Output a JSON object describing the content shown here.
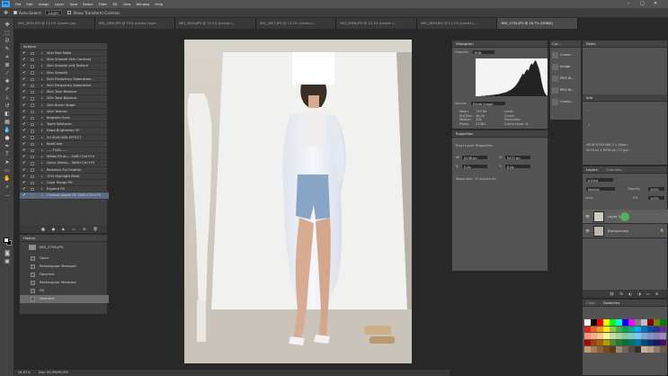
{
  "app": {
    "logo": "Ps",
    "menu": [
      "File",
      "Edit",
      "Image",
      "Layer",
      "Type",
      "Select",
      "Filter",
      "3D",
      "View",
      "Window",
      "Help"
    ],
    "window_controls": [
      "–",
      "□",
      "✕"
    ]
  },
  "options_bar": {
    "auto_select_label": "Auto-Select:",
    "auto_select_value": "Layer",
    "show_transform_label": "Show Transform Controls"
  },
  "doc_tabs": [
    {
      "label": "IMG_2855.JPG @ 13.1% (Levels Lay...",
      "active": false
    },
    {
      "label": "IMG_2856.JPG @ 10% (Levels Layer...",
      "active": false
    },
    {
      "label": "IMG_2855.JPG @ 13.1% (Levels L...",
      "active": false
    },
    {
      "label": "IMG_2857.JPG @ 13.1% (Levels L...",
      "active": false
    },
    {
      "label": "IMG_2858.JPG @ 13.1% (Levels L...",
      "active": false
    },
    {
      "label": "IMG_2859.JPG @ 11.1% (Levels L...",
      "active": false
    },
    {
      "label": "IMG_2795.JPG @ 16.7% (RGB/8)",
      "active": true
    }
  ],
  "actions": {
    "title": "Actions",
    "items": [
      "Skin Fast Make",
      "Skin Smooth Skin Contrast",
      "Skin Smooth and Texture",
      "Skin Smooth",
      "Skin Frequency Separation...",
      "Skin Frequency Separation",
      "Skin Tone Balance",
      "Skin Tone Balance",
      "Skin Brush Stage",
      "Skin Texture",
      "Brighten Eyes",
      "Teeth Whitener",
      "Fixed Brightness UP",
      "20 Shift HDR EFFECT",
      "BoldColor",
      "-----TOOL-----",
      "White Fill on...  Shift+Ctrl+F4",
      "Quick Select...  Shift+Ctrl+F5",
      "Rematch For Feather",
      "10% Highlight Mask",
      "Color Range Fill",
      "Expand Fill",
      "Content Aware Fill  Shift+Ctrl+F3"
    ],
    "selected_index": 22
  },
  "history": {
    "title": "History",
    "snapshot": "IMG_2795.JPG",
    "items": [
      "Open",
      "Rectangular Marquee",
      "Deselect",
      "Rectangular Marquee",
      "Fill",
      "Deselect"
    ],
    "selected_index": 5
  },
  "histogram": {
    "title": "Histogram",
    "channel_label": "Channel:",
    "channel_value": "RGB",
    "source_label": "Source:",
    "source_value": "Entire Image",
    "stats_left": [
      [
        "Mean:",
        "199.56"
      ],
      [
        "Std Dev:",
        "46.49"
      ],
      [
        "Median:",
        "208"
      ],
      [
        "Pixels:",
        "21384"
      ]
    ],
    "stats_right": [
      [
        "Level:",
        ""
      ],
      [
        "Count:",
        ""
      ],
      [
        "Percentile:",
        ""
      ],
      [
        "Cache Level:",
        "8"
      ]
    ],
    "curve": [
      0,
      0,
      0,
      0,
      1,
      1,
      1,
      2,
      2,
      2,
      3,
      3,
      4,
      4,
      5,
      5,
      6,
      7,
      8,
      9,
      10,
      11,
      13,
      15,
      17,
      20,
      23,
      27,
      32,
      38,
      45,
      52,
      60,
      58,
      66,
      72,
      68,
      80,
      88,
      84,
      92,
      96,
      86,
      76,
      60,
      38,
      22,
      10,
      4,
      1
    ]
  },
  "properties": {
    "title": "Properties",
    "layer_type": "Pixel Layer Properties",
    "w_label": "W:",
    "w_value": "4136 px",
    "h_label": "H:",
    "h_value": "5472 px",
    "x_label": "X:",
    "x_value": "0 px",
    "y_label": "Y:",
    "y_value": "0 px",
    "resolution": "Resolution: 72 pixels/inch"
  },
  "side_strip": {
    "tab": "Cur...",
    "items": [
      "Conve...",
      "Image",
      "PRO W...",
      "PRO W...",
      "Combi..."
    ]
  },
  "paths": {
    "title": "Paths",
    "info_title": "Info"
  },
  "info": {
    "doc_line": "sRGB IEC61966-2.1 (8bpc)",
    "size_line": "4016 px x 6016 px (72 ppi)"
  },
  "layers": {
    "tabs": [
      "Layers",
      "Channels"
    ],
    "kind_label": "ρ Kind",
    "blend_mode": "Normal",
    "opacity_label": "Opacity:",
    "opacity_value": "100%",
    "lock_label": "Lock:",
    "fill_label": "Fill:",
    "fill_value": "100%",
    "items": [
      {
        "name": "Layer 1",
        "selected": true
      },
      {
        "name": "Background",
        "selected": false
      }
    ]
  },
  "swatches": {
    "tabs": [
      "Color",
      "Swatches"
    ],
    "colors": [
      "#ffffff",
      "#000000",
      "#ff0000",
      "#ffff00",
      "#00ff00",
      "#00ffff",
      "#0000ff",
      "#ff00ff",
      "#808080",
      "#c0c0c0",
      "#800000",
      "#808000",
      "#008000",
      "#ed1c24",
      "#f26522",
      "#f7941d",
      "#fff200",
      "#8dc63f",
      "#39b54a",
      "#00a651",
      "#00a99d",
      "#00aeef",
      "#0072bc",
      "#0054a6",
      "#2e3192",
      "#662d91",
      "#f69679",
      "#f9ad81",
      "#fdc689",
      "#fff799",
      "#c4df9b",
      "#a3d39c",
      "#82ca9d",
      "#7accc8",
      "#6dcff6",
      "#7da7d9",
      "#8393ca",
      "#8781bd",
      "#a187be",
      "#9e0b0f",
      "#a0410d",
      "#a36209",
      "#aba000",
      "#598527",
      "#197b30",
      "#007236",
      "#00746b",
      "#0076a3",
      "#004b80",
      "#003471",
      "#1b1464",
      "#440e62",
      "#c69c6d",
      "#a67c52",
      "#8c6239",
      "#754c24",
      "#603913",
      "#998675",
      "#736357",
      "#534741",
      "#362f2d",
      "#c7b299",
      "#b5a088",
      "#8f7b6b",
      "#6b5a4d"
    ]
  },
  "status": {
    "zoom": "16.67%",
    "doc": "Doc: 65.9M/65.9M"
  }
}
